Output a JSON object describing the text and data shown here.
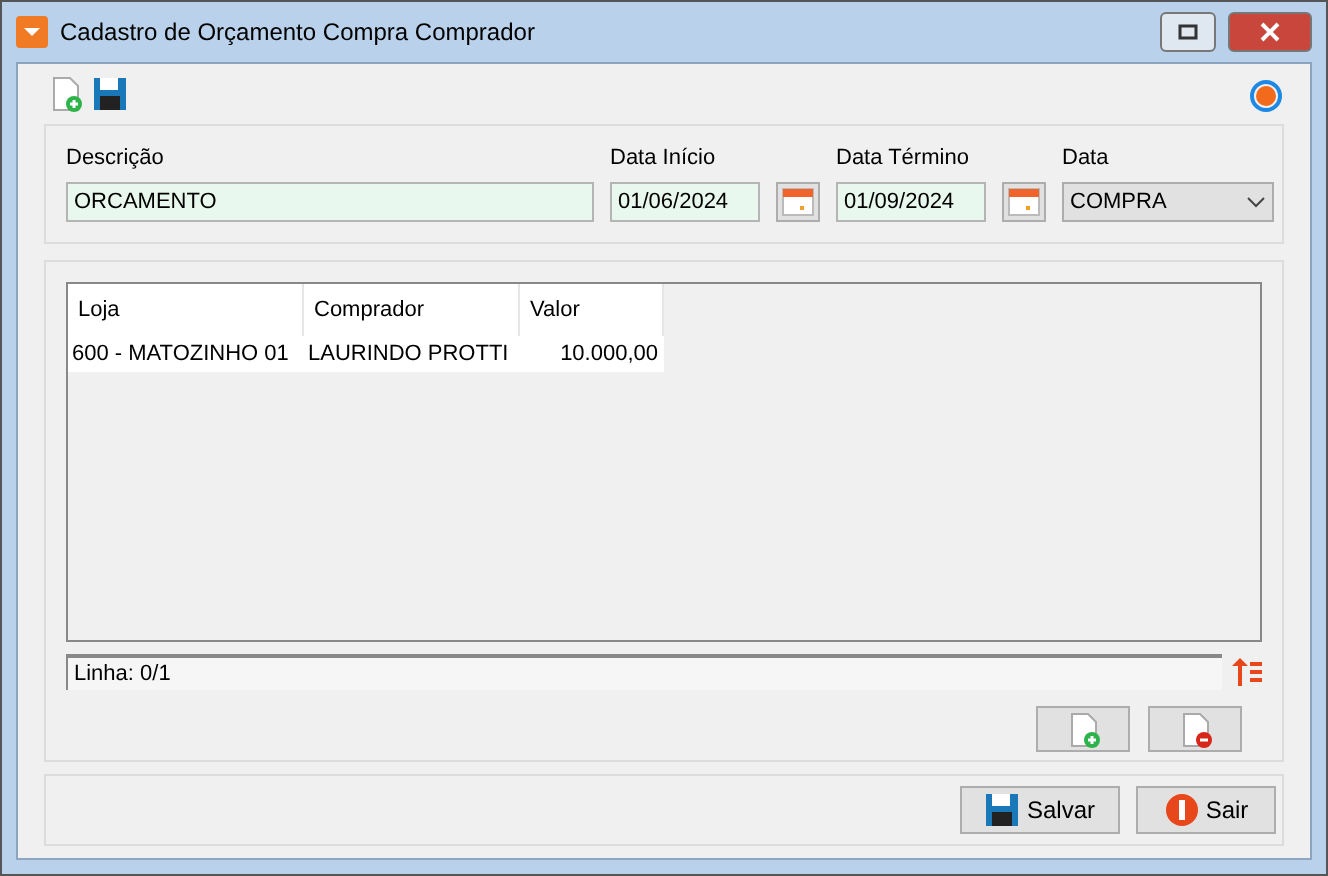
{
  "window": {
    "title": "Cadastro de Orçamento Compra Comprador"
  },
  "fields": [
    {
      "label": "Descrição",
      "kind": "text",
      "value": "ORCAMENTO"
    },
    {
      "label": "Data Início",
      "kind": "date",
      "value": "01/06/2024"
    },
    {
      "label": "Data Término",
      "kind": "date",
      "value": "01/09/2024"
    },
    {
      "label": "Data",
      "kind": "select",
      "value": "COMPRA"
    }
  ],
  "table": {
    "columns": [
      "Loja",
      "Comprador",
      "Valor"
    ],
    "rows": [
      [
        "600 - MATOZINHO 01",
        "LAURINDO PROTTI",
        "10.000,00"
      ]
    ]
  },
  "status_bar": "Linha: 0/1",
  "buttons": [
    "Salvar",
    "Sair"
  ]
}
